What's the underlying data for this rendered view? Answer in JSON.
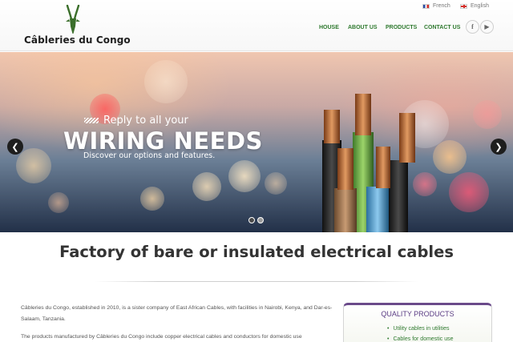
{
  "header": {
    "logo_text": "Câbleries du Congo",
    "languages": [
      {
        "label": "French",
        "flag": "flag-fr-icon"
      },
      {
        "label": "English",
        "flag": "flag-gb-icon"
      }
    ],
    "nav": [
      "HOUSE",
      "ABOUT US",
      "PRODUCTS",
      "CONTACT US"
    ],
    "social": [
      {
        "glyph": "f",
        "icon": "facebook-icon"
      },
      {
        "glyph": "▶",
        "icon": "youtube-icon"
      }
    ]
  },
  "hero": {
    "tagline": "Reply to all your",
    "title": "WIRING NEEDS",
    "subtitle": "Discover our options and features.",
    "prev_glyph": "❮",
    "next_glyph": "❯",
    "slides": 2,
    "active_slide": 1
  },
  "main": {
    "heading": "Factory of bare or insulated electrical cables",
    "paragraph_1": "Câbleries du Congo, established in 2010, is a sister company of East African Cables, with facilities in Nairobi, Kenya, and Dar-es-Salaam, Tanzania.",
    "paragraph_2": "The products manufactured by Câbleries du Congo include copper electrical cables and conductors for domestic use"
  },
  "quality_products": {
    "title": "QUALITY PRODUCTS",
    "items": [
      "Utility cables in utilities",
      "Cables for domestic use"
    ]
  },
  "colors": {
    "nav_green": "#2f7a2f",
    "box_purple": "#5b3c84",
    "logo_green": "#3a6e2a"
  }
}
